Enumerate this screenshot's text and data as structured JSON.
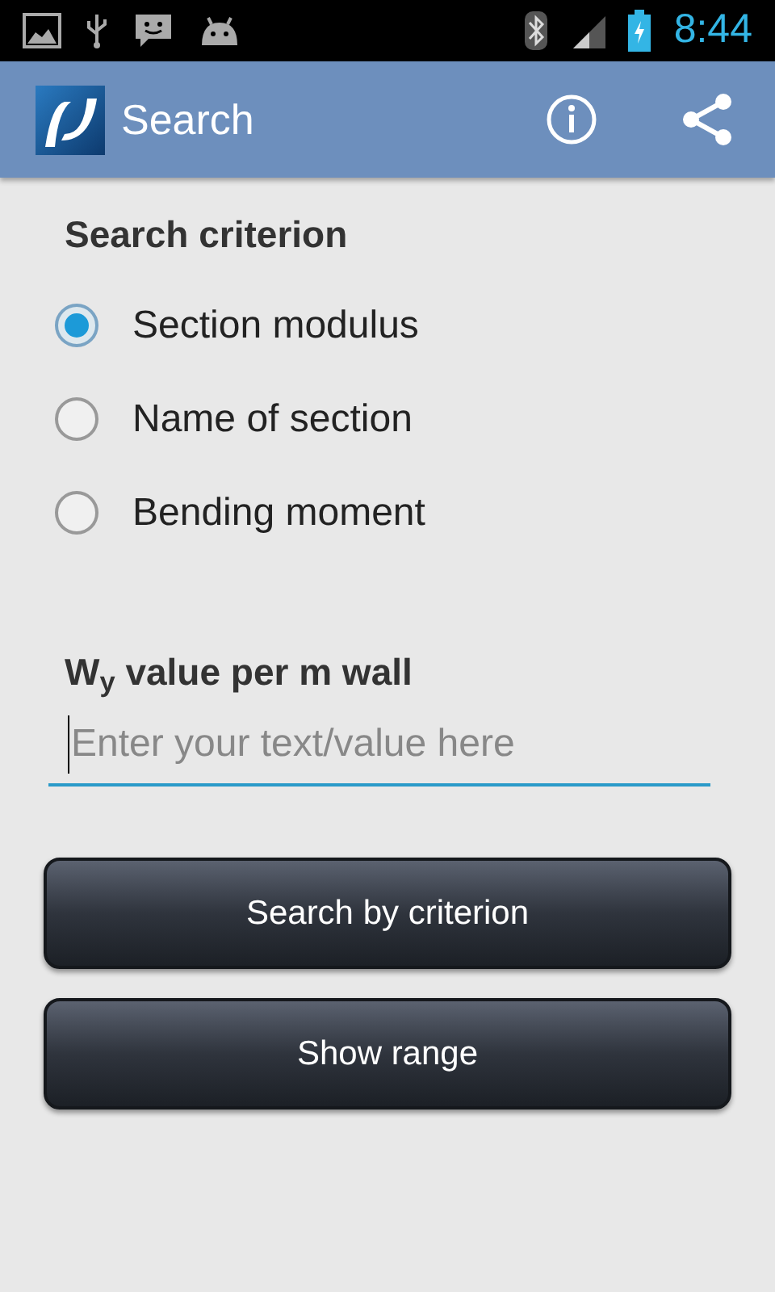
{
  "status_bar": {
    "time": "8:44"
  },
  "app_bar": {
    "title": "Search"
  },
  "criterion": {
    "heading": "Search criterion",
    "options": [
      {
        "label": "Section modulus",
        "selected": true
      },
      {
        "label": "Name of section",
        "selected": false
      },
      {
        "label": "Bending moment",
        "selected": false
      }
    ]
  },
  "value_field": {
    "label": "W$_{y}$ value per m wall",
    "placeholder": "Enter your text/value here"
  },
  "buttons": [
    "Search by criterion",
    "Show range"
  ]
}
